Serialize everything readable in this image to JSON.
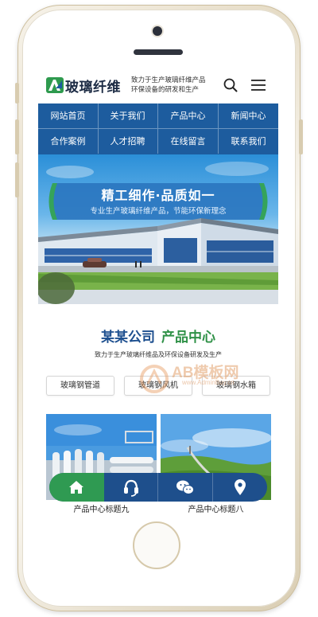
{
  "header": {
    "logo_text": "玻璃纤维",
    "slogan_line1": "致力于生产玻璃纤维产品",
    "slogan_line2": "环保设备的研发和生产"
  },
  "nav": {
    "items": [
      "网站首页",
      "关于我们",
      "产品中心",
      "新闻中心",
      "合作案例",
      "人才招聘",
      "在线留言",
      "联系我们"
    ]
  },
  "banner": {
    "title": "精工细作·品质如一",
    "subtitle": "专业生产玻璃纤维产品，节能环保新理念"
  },
  "section": {
    "company": "某某公司",
    "title": "产品中心",
    "tagline": "致力于生产玻璃纤维品及环保设备研发及生产"
  },
  "categories": [
    "玻璃钢管道",
    "玻璃钢风机",
    "玻璃钢水箱"
  ],
  "products": [
    {
      "caption": "产品中心标题九"
    },
    {
      "caption": "产品中心标题八"
    }
  ],
  "bottom_bar": {
    "icons": [
      "home-icon",
      "headset-icon",
      "wechat-icon",
      "location-icon"
    ],
    "colors": {
      "home": "#2f9a52",
      "bar": "#1e4f8c"
    }
  },
  "watermark": {
    "text": "AB模板网",
    "url": "www.AdminBuy.cn"
  },
  "colors": {
    "nav": "#1d5c9e",
    "accent_blue": "#1d4f8f",
    "accent_green": "#2f9147"
  }
}
